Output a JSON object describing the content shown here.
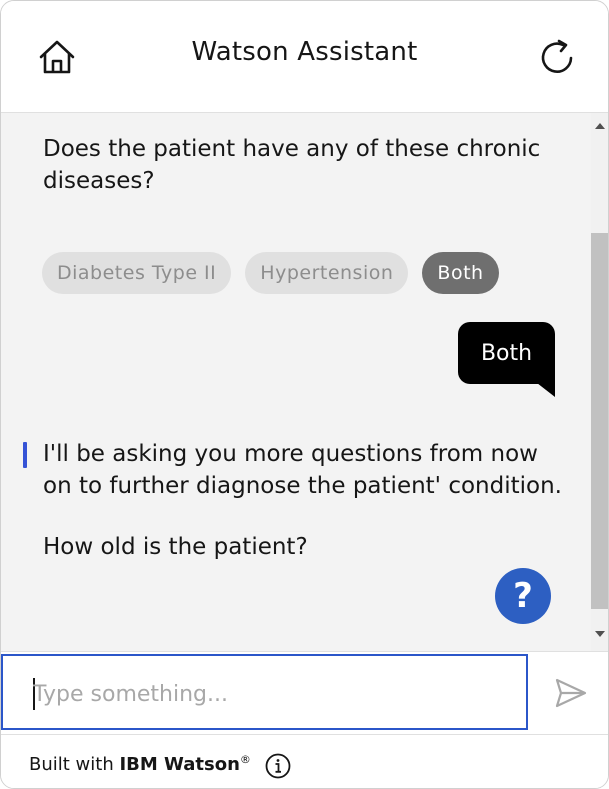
{
  "header": {
    "title": "Watson Assistant",
    "home_icon": "home-icon",
    "restart_icon": "restart-icon"
  },
  "conversation": {
    "question_1": "Does the patient have any of these chronic diseases?",
    "options": [
      {
        "label": "Diabetes Type II",
        "selected": false
      },
      {
        "label": "Hypertension",
        "selected": false
      },
      {
        "label": "Both",
        "selected": true
      }
    ],
    "user_reply": "Both",
    "bot_message_1": "I'll be asking you more questions from now on to further diagnose the patient' condition.",
    "bot_message_2": "How old is the patient?",
    "help_label": "?"
  },
  "input": {
    "placeholder": "Type something...",
    "value": ""
  },
  "footer": {
    "prefix": "Built with ",
    "brand": "IBM Watson",
    "registered": "®"
  },
  "colors": {
    "accent": "#2b56c9",
    "help_button": "#2d5fc2",
    "bot_indicator": "#3553d6",
    "user_bubble": "#000000",
    "selected_option": "#6f6f6f"
  }
}
